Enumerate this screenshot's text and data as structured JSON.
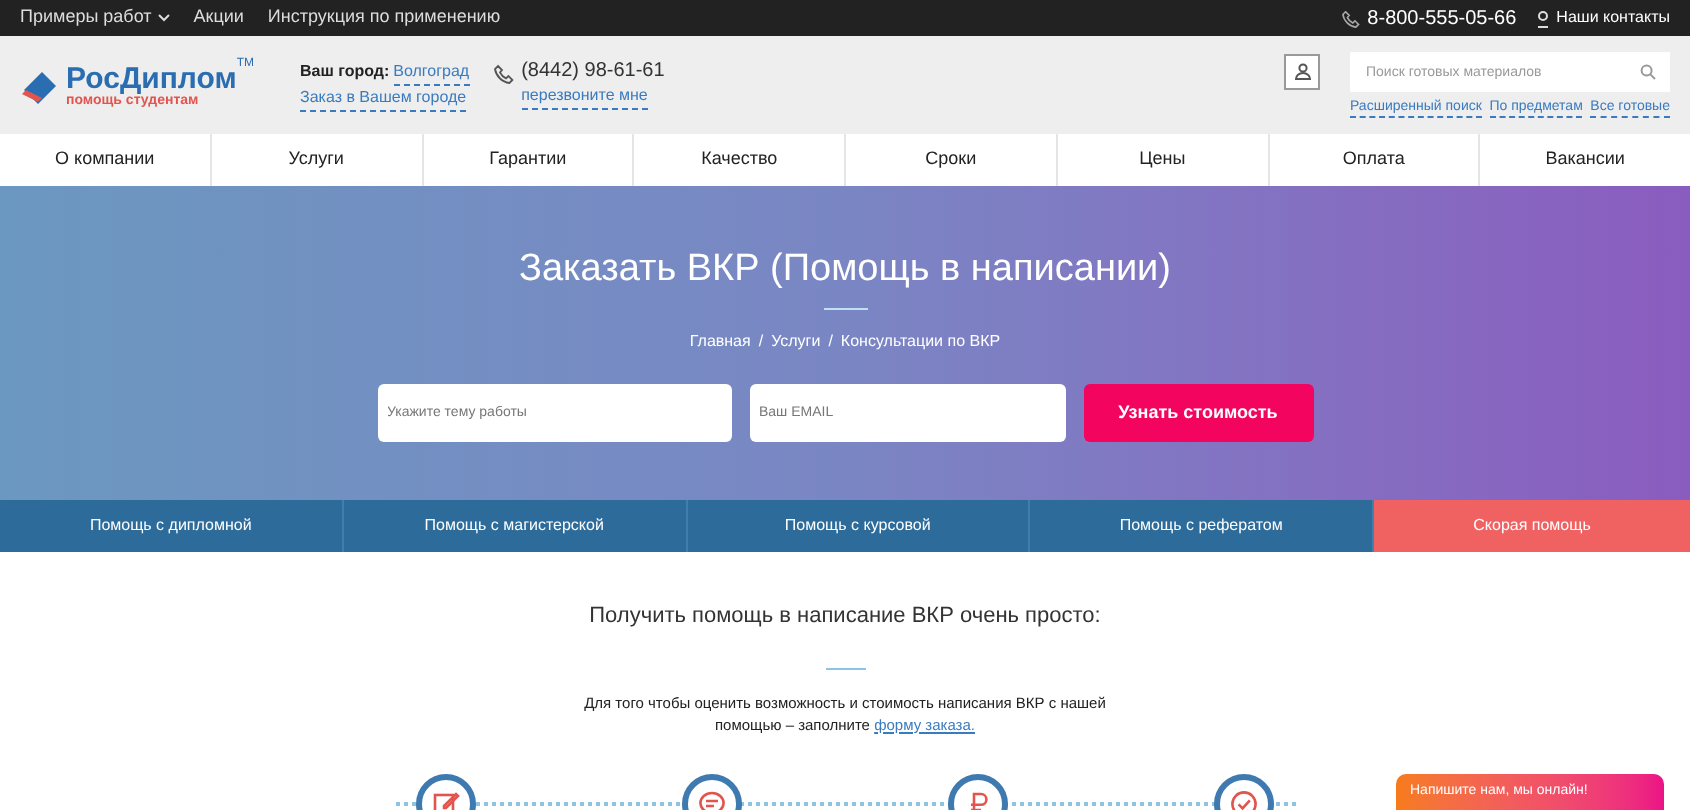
{
  "top_bar": {
    "links": [
      {
        "label": "Примеры работ",
        "has_caret": true
      },
      {
        "label": "Акции",
        "has_caret": false
      },
      {
        "label": "Инструкция по применению",
        "has_caret": false
      }
    ],
    "phone": "8-800-555-05-66",
    "contacts": "Наши контакты"
  },
  "header": {
    "logo": {
      "name": "РосДиплом",
      "tm": "TM",
      "tagline": "помощь студентам"
    },
    "city_label": "Ваш город:",
    "city": "Волгоград",
    "city_order": "Заказ в Вашем городе",
    "phone": "(8442) 98-61-61",
    "callback": "перезвоните мне",
    "search": {
      "placeholder": "Поиск готовых материалов"
    },
    "search_links": [
      "Расширенный поиск",
      "По предметам",
      "Все готовые"
    ]
  },
  "nav": [
    "О компании",
    "Услуги",
    "Гарантии",
    "Качество",
    "Сроки",
    "Цены",
    "Оплата",
    "Вакансии"
  ],
  "hero": {
    "title": "Заказать ВКР (Помощь в написании)",
    "breadcrumbs": [
      "Главная",
      "Услуги",
      "Консультации по ВКР"
    ],
    "breadcrumb_separator": "/",
    "topic_field": {
      "placeholder": "Укажите тему работы"
    },
    "email_field": {
      "placeholder": "Ваш EMAIL"
    },
    "submit": "Узнать стоимость"
  },
  "service_tabs": [
    {
      "label": "Помощь с дипломной",
      "selected": false
    },
    {
      "label": "Помощь с магистерской",
      "selected": false
    },
    {
      "label": "Помощь с курсовой",
      "selected": false
    },
    {
      "label": "Помощь с рефератом",
      "selected": false
    },
    {
      "label": "Скорая помощь",
      "selected": true
    }
  ],
  "content": {
    "heading": "Получить помощь в написание ВКР очень просто:",
    "intro": "Для того чтобы оценить возможность и стоимость написания ВКР с нашей помощью – заполните",
    "intro_link": "форму заказа.",
    "steps": [
      {
        "kind": "edit"
      },
      {
        "kind": "chat"
      },
      {
        "kind": "ruble"
      },
      {
        "kind": "check"
      }
    ]
  },
  "chat_widget": {
    "label": "Напишите нам, мы онлайн!"
  }
}
